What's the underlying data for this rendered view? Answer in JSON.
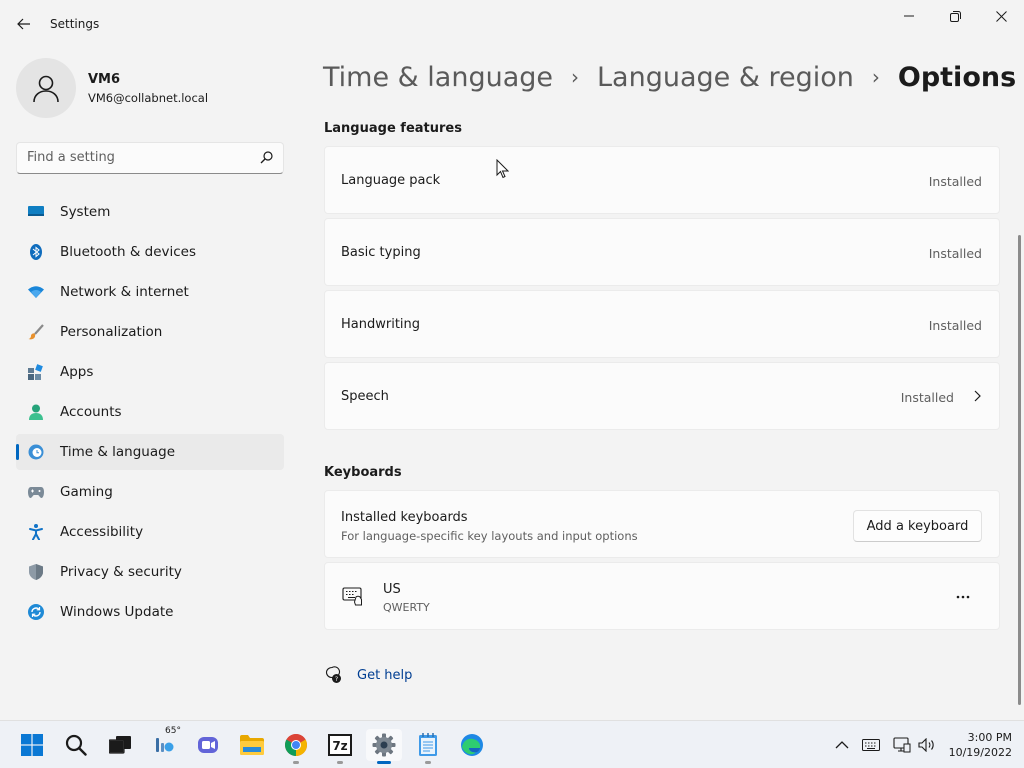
{
  "window": {
    "title": "Settings"
  },
  "user": {
    "name": "VM6",
    "email": "VM6@collabnet.local"
  },
  "search": {
    "placeholder": "Find a setting"
  },
  "sidebar": {
    "items": [
      {
        "label": "System",
        "icon": "system-icon"
      },
      {
        "label": "Bluetooth & devices",
        "icon": "bluetooth-icon"
      },
      {
        "label": "Network & internet",
        "icon": "wifi-icon"
      },
      {
        "label": "Personalization",
        "icon": "brush-icon"
      },
      {
        "label": "Apps",
        "icon": "apps-icon"
      },
      {
        "label": "Accounts",
        "icon": "accounts-icon"
      },
      {
        "label": "Time & language",
        "icon": "time-language-icon",
        "active": true
      },
      {
        "label": "Gaming",
        "icon": "gamepad-icon"
      },
      {
        "label": "Accessibility",
        "icon": "accessibility-icon"
      },
      {
        "label": "Privacy & security",
        "icon": "shield-icon"
      },
      {
        "label": "Windows Update",
        "icon": "update-icon"
      }
    ]
  },
  "breadcrumb": {
    "items": [
      "Time & language",
      "Language & region"
    ],
    "current": "Options"
  },
  "language_features": {
    "title": "Language features",
    "items": [
      {
        "label": "Language pack",
        "status": "Installed"
      },
      {
        "label": "Basic typing",
        "status": "Installed"
      },
      {
        "label": "Handwriting",
        "status": "Installed"
      },
      {
        "label": "Speech",
        "status": "Installed"
      }
    ]
  },
  "keyboards": {
    "title": "Keyboards",
    "installed_title": "Installed keyboards",
    "installed_subtitle": "For language-specific key layouts and input options",
    "add_button": "Add a keyboard",
    "layout_title": "US",
    "layout_subtitle": "QWERTY"
  },
  "help": {
    "label": "Get help"
  },
  "taskbar": {
    "weather_temp": "65°",
    "time": "3:00 PM",
    "date": "10/19/2022"
  },
  "colors": {
    "accent": "#0067c0",
    "background": "#f3f3f3",
    "card": "#fbfbfb"
  }
}
